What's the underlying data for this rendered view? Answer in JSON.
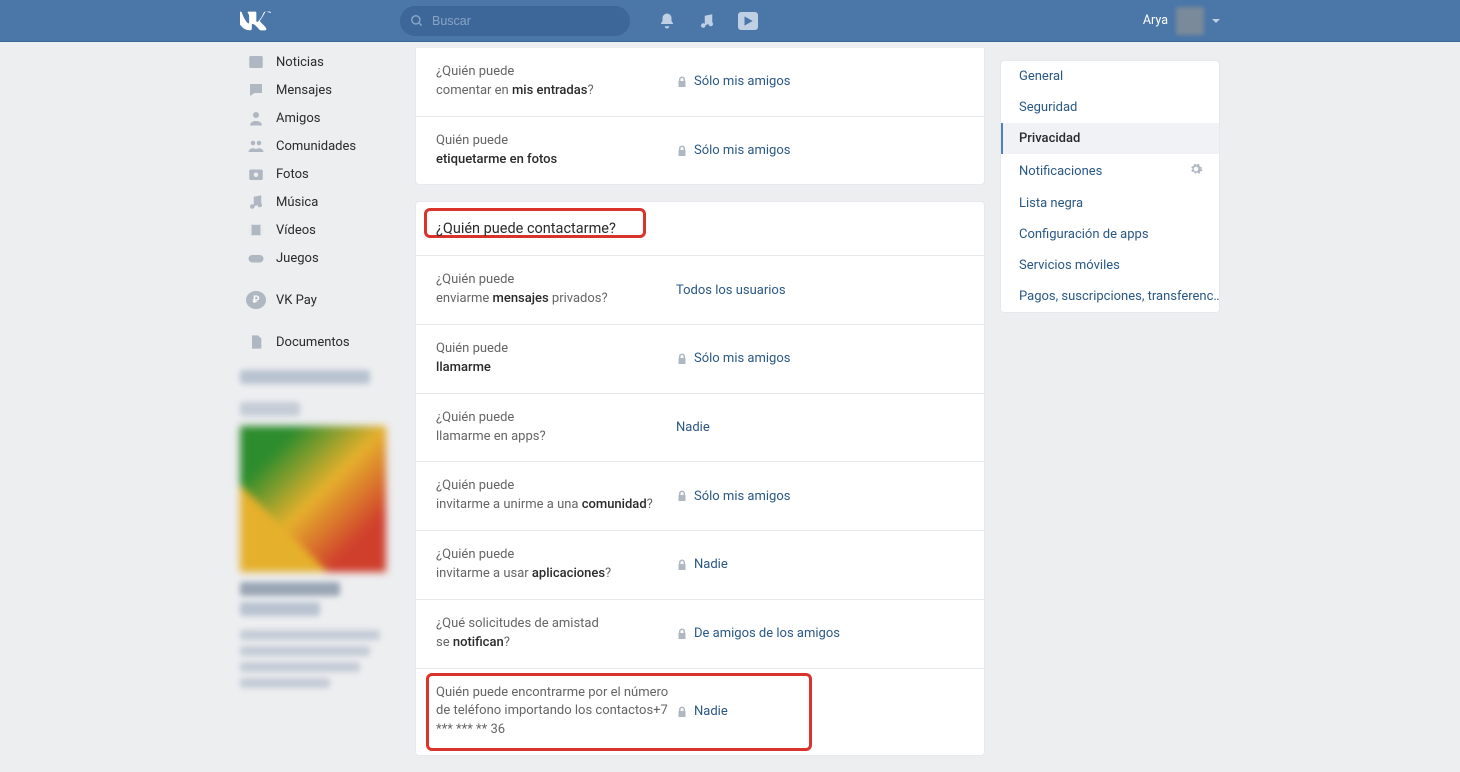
{
  "header": {
    "search_placeholder": "Buscar",
    "username": "Arya"
  },
  "sidebar": {
    "items": [
      {
        "icon": "news",
        "label": "Noticias"
      },
      {
        "icon": "messages",
        "label": "Mensajes"
      },
      {
        "icon": "friends",
        "label": "Amigos"
      },
      {
        "icon": "communities",
        "label": "Comunidades"
      },
      {
        "icon": "photos",
        "label": "Fotos"
      },
      {
        "icon": "music",
        "label": "Música"
      },
      {
        "icon": "videos",
        "label": "Vídeos"
      },
      {
        "icon": "games",
        "label": "Juegos"
      }
    ],
    "pay_label": "VK Pay",
    "docs_label": "Documentos"
  },
  "section1": {
    "rows": [
      {
        "q1": "¿Quién puede",
        "q2": "comentar en ",
        "b": "mis entradas",
        "q3": "?",
        "locked": true,
        "value": "Sólo mis amigos"
      },
      {
        "q1": "Quién puede ",
        "q2": "",
        "b": "etiquetarme en fotos",
        "q3": "",
        "locked": true,
        "value": "Sólo mis amigos"
      }
    ]
  },
  "section2": {
    "heading": "¿Quién puede contactarme?",
    "rows": [
      {
        "q1": "¿Quién puede",
        "q2": "enviarme ",
        "b": "mensajes",
        "q3": " privados?",
        "locked": false,
        "value": "Todos los usuarios"
      },
      {
        "q1": "Quién puede",
        "q2": "",
        "b": "llamarme",
        "q3": "",
        "locked": true,
        "value": "Sólo mis amigos"
      },
      {
        "q1": "¿Quién puede",
        "q2": "llamarme en apps?",
        "b": "",
        "q3": "",
        "locked": false,
        "value": "Nadie"
      },
      {
        "q1": "¿Quién puede",
        "q2": "invitarme a unirme a una ",
        "b": "comunidad",
        "q3": "?",
        "locked": true,
        "value": "Sólo mis amigos"
      },
      {
        "q1": "¿Quién puede",
        "q2": "invitarme a usar ",
        "b": "aplicaciones",
        "q3": "?",
        "locked": true,
        "value": "Nadie"
      },
      {
        "q1": "¿Qué solicitudes de amistad",
        "q2": "se ",
        "b": "notifican",
        "q3": "?",
        "locked": true,
        "value": "De amigos de los amigos"
      },
      {
        "q1": "Quién puede encontrarme por el número de teléfono importando los contactos+7 *** *** ** 36",
        "q2": "",
        "b": "",
        "q3": "",
        "locked": true,
        "value": "Nadie",
        "highlight": true
      }
    ]
  },
  "rightnav": {
    "items": [
      {
        "label": "General"
      },
      {
        "label": "Seguridad"
      },
      {
        "label": "Privacidad",
        "active": true
      },
      {
        "label": "Notificaciones",
        "gear": true
      },
      {
        "label": "Lista negra"
      },
      {
        "label": "Configuración de apps"
      },
      {
        "label": "Servicios móviles"
      },
      {
        "label": "Pagos, suscripciones, transferenc…"
      }
    ]
  }
}
